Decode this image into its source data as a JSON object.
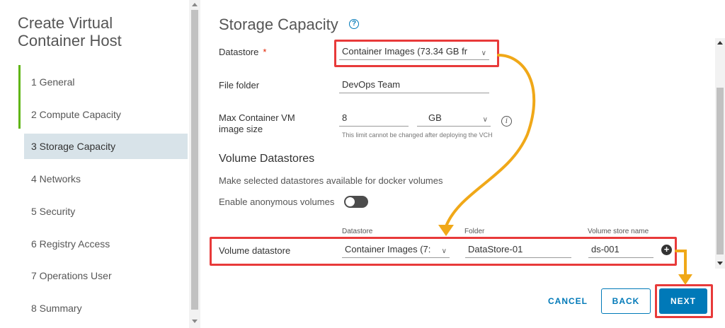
{
  "wizard": {
    "title": "Create Virtual Container Host",
    "steps": [
      {
        "label": "1 General"
      },
      {
        "label": "2 Compute Capacity"
      },
      {
        "label": "3 Storage Capacity"
      },
      {
        "label": "4 Networks"
      },
      {
        "label": "5 Security"
      },
      {
        "label": "6 Registry Access"
      },
      {
        "label": "7 Operations User"
      },
      {
        "label": "8 Summary"
      }
    ],
    "active_step_index": 2
  },
  "main": {
    "title": "Storage Capacity",
    "help_icon": "help-circle-icon",
    "datastore": {
      "label": "Datastore",
      "required_mark": "*",
      "value": "Container Images (73.34 GB fr"
    },
    "file_folder": {
      "label": "File folder",
      "value": "DevOps Team"
    },
    "max_image_size": {
      "label_line1": "Max Container VM",
      "label_line2": "image size",
      "value": "8",
      "unit": "GB",
      "hint": "This limit cannot be changed after deploying the VCH"
    },
    "volume_section": {
      "title": "Volume Datastores",
      "description": "Make selected datastores available for docker volumes",
      "anonymous_label": "Enable anonymous volumes",
      "anonymous_enabled": false,
      "columns": {
        "datastore": "Datastore",
        "folder": "Folder",
        "store_name": "Volume store name"
      },
      "row": {
        "label": "Volume datastore",
        "datastore": "Container Images (7:",
        "folder": "DataStore-01",
        "store_name": "ds-001"
      }
    }
  },
  "footer": {
    "cancel": "CANCEL",
    "back": "BACK",
    "next": "NEXT"
  },
  "colors": {
    "accent": "#0079b8",
    "highlight": "#e83a3a",
    "arrow": "#f0a818",
    "progress": "#60b515"
  }
}
